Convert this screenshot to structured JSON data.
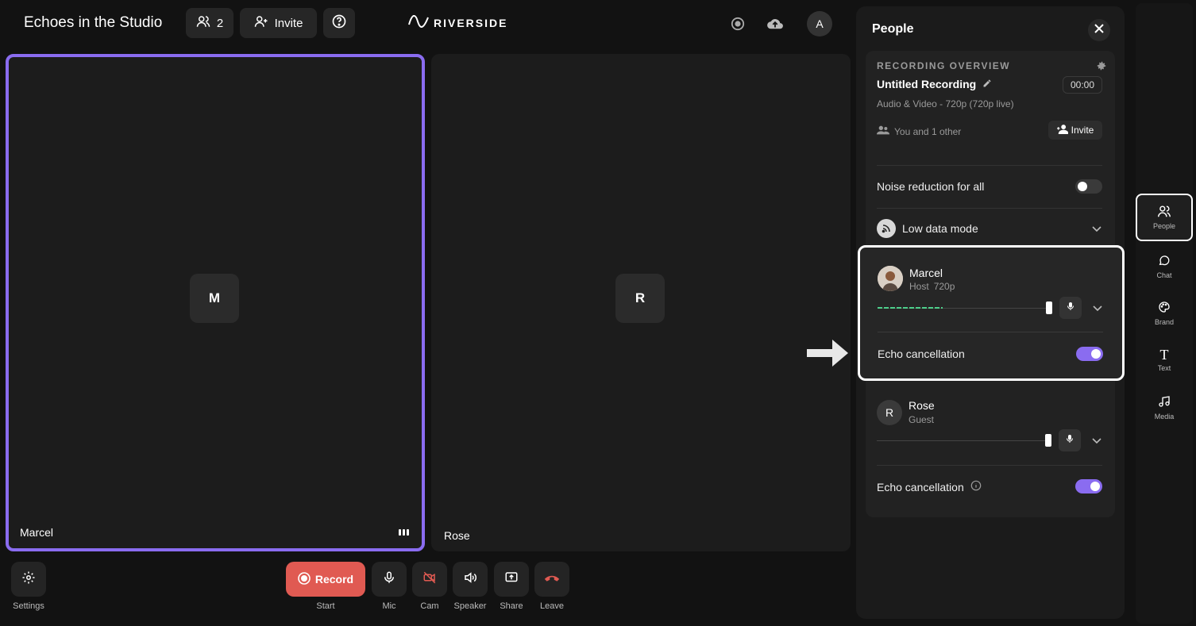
{
  "header": {
    "title": "Echoes in the Studio",
    "participants_count": "2",
    "invite_label": "Invite",
    "logo_text": "RIVERSIDE",
    "avatar_initial": "A"
  },
  "tiles": [
    {
      "name": "Marcel",
      "initial": "M"
    },
    {
      "name": "Rose",
      "initial": "R"
    }
  ],
  "controls": {
    "settings": "Settings",
    "record": "Record",
    "start": "Start",
    "mic": "Mic",
    "cam": "Cam",
    "speaker": "Speaker",
    "share": "Share",
    "leave": "Leave"
  },
  "panel": {
    "title": "People",
    "overview_label": "RECORDING OVERVIEW",
    "recording_title": "Untitled Recording",
    "recording_sub": "Audio & Video - 720p (720p live)",
    "timer": "00:00",
    "participants_text": "You and 1 other",
    "invite_label": "Invite",
    "noise_reduction": "Noise reduction for all",
    "low_data": "Low data mode",
    "people": [
      {
        "name": "Marcel",
        "role": "Host",
        "quality": "720p",
        "echo": "Echo cancellation",
        "level": 0.38
      },
      {
        "name": "Rose",
        "role": "Guest",
        "initial": "R",
        "echo": "Echo cancellation"
      }
    ]
  },
  "rail": {
    "people": "People",
    "chat": "Chat",
    "brand": "Brand",
    "text": "Text",
    "media": "Media"
  },
  "colors": {
    "accent": "#8a6cf0",
    "record": "#e05a52",
    "leave": "#e05a52",
    "level": "#4ecf8b"
  }
}
